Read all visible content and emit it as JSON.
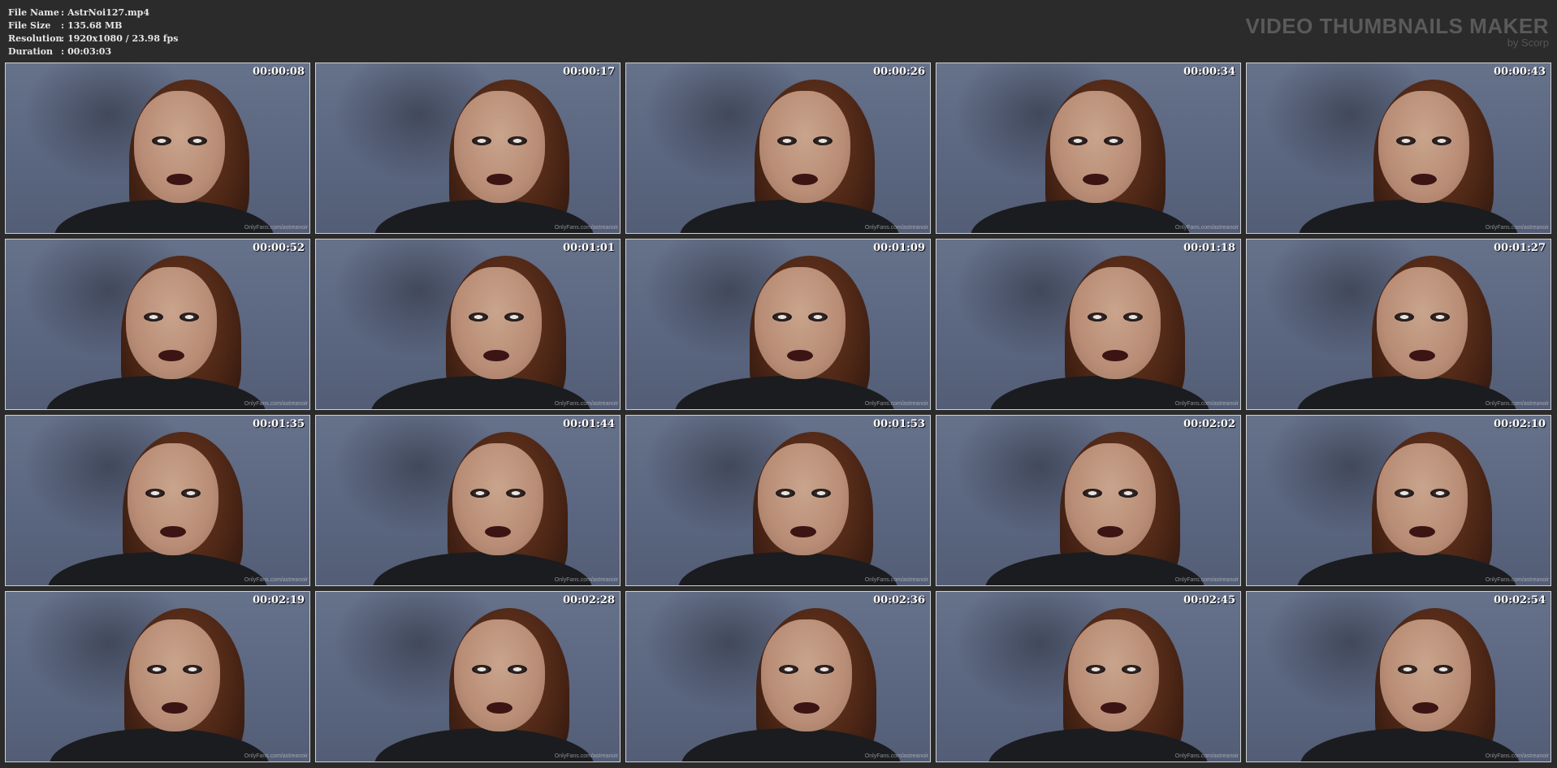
{
  "file_info": {
    "name_label": "File Name",
    "name_value": "AstrNoi127.mp4",
    "size_label": "File Size",
    "size_value": "135.68 MB",
    "resolution_label": "Resolution",
    "resolution_value": "1920x1080 / 23.98 fps",
    "duration_label": "Duration",
    "duration_value": "00:03:03",
    "separator": ":"
  },
  "brand": {
    "title": "VIDEO THUMBNAILS MAKER",
    "subtitle": "by Scorp"
  },
  "watermark": "OnlyFans.com/astreanoir",
  "thumbnails": [
    {
      "time": "00:00:08"
    },
    {
      "time": "00:00:17"
    },
    {
      "time": "00:00:26"
    },
    {
      "time": "00:00:34"
    },
    {
      "time": "00:00:43"
    },
    {
      "time": "00:00:52"
    },
    {
      "time": "00:01:01"
    },
    {
      "time": "00:01:09"
    },
    {
      "time": "00:01:18"
    },
    {
      "time": "00:01:27"
    },
    {
      "time": "00:01:35"
    },
    {
      "time": "00:01:44"
    },
    {
      "time": "00:01:53"
    },
    {
      "time": "00:02:02"
    },
    {
      "time": "00:02:10"
    },
    {
      "time": "00:02:19"
    },
    {
      "time": "00:02:28"
    },
    {
      "time": "00:02:36"
    },
    {
      "time": "00:02:45"
    },
    {
      "time": "00:02:54"
    }
  ]
}
